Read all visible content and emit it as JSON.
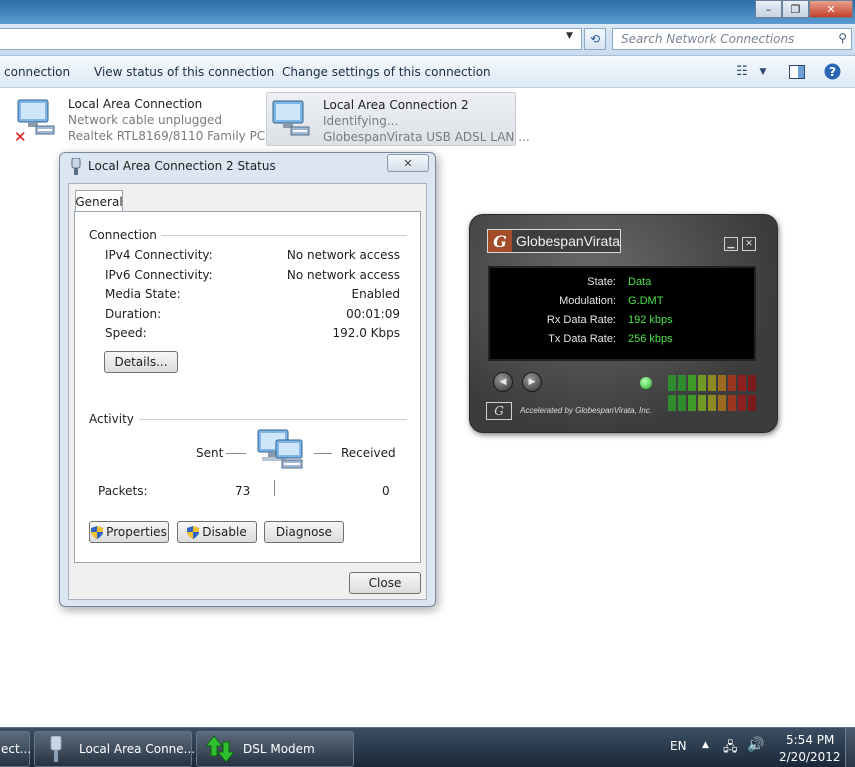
{
  "explorer": {
    "search_placeholder": "Search Network Connections",
    "commands": [
      "connection",
      "View status of this connection",
      "Change settings of this connection"
    ],
    "window_controls": {
      "minimize": "–",
      "restore": "❐",
      "close": "✕"
    }
  },
  "connections": [
    {
      "name": "Local Area Connection",
      "status": "Network cable unplugged",
      "device": "Realtek RTL8169/8110 Family PCI ..."
    },
    {
      "name": "Local Area Connection 2",
      "status": "Identifying...",
      "device": "GlobespanVirata USB ADSL LAN ..."
    }
  ],
  "status_dialog": {
    "title": "Local Area Connection 2 Status",
    "tab": "General",
    "connection_group": "Connection",
    "rows": [
      {
        "label": "IPv4 Connectivity:",
        "value": "No network access"
      },
      {
        "label": "IPv6 Connectivity:",
        "value": "No network access"
      },
      {
        "label": "Media State:",
        "value": "Enabled"
      },
      {
        "label": "Duration:",
        "value": "00:01:09"
      },
      {
        "label": "Speed:",
        "value": "192.0 Kbps"
      }
    ],
    "details_button": "Details...",
    "activity_group": "Activity",
    "sent_label": "Sent",
    "received_label": "Received",
    "packets_label": "Packets:",
    "packets_sent": "73",
    "packets_received": "0",
    "properties_button": "Properties",
    "disable_button": "Disable",
    "diagnose_button": "Diagnose",
    "close_button": "Close"
  },
  "modem": {
    "brand": "GlobespanVirata",
    "logo_letter": "G",
    "rows": [
      {
        "label": "State:",
        "value": "Data"
      },
      {
        "label": "Modulation:",
        "value": "G.DMT"
      },
      {
        "label": "Rx Data Rate:",
        "value": "192 kbps"
      },
      {
        "label": "Tx Data Rate:",
        "value": "256 kbps"
      }
    ],
    "footer": "Accelerated by GlobespanVirata, Inc.",
    "colors": {
      "value_text": "#4ee04e",
      "logo_accent": "#a34c2a"
    }
  },
  "taskbar": {
    "items": [
      "ect...",
      "Local Area Conne...",
      "DSL Modem"
    ],
    "language": "EN",
    "time": "5:54 PM",
    "date": "2/20/2012"
  }
}
